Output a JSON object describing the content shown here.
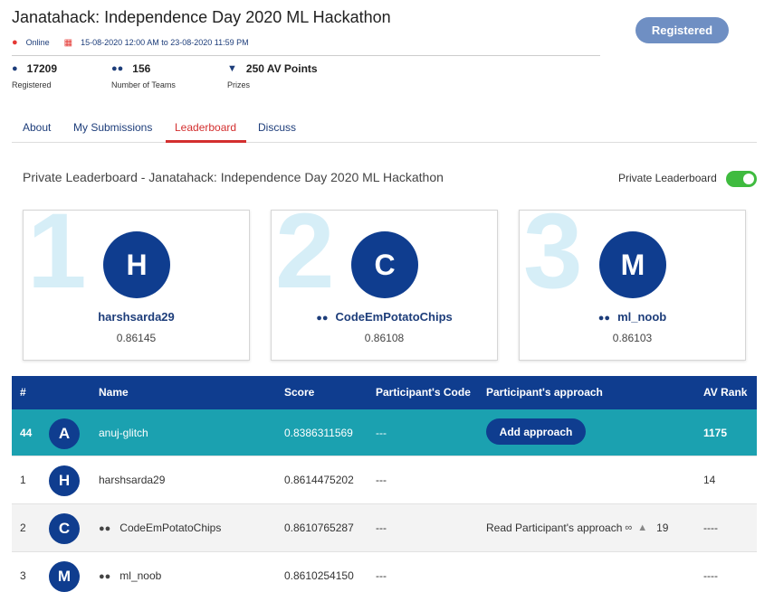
{
  "event": {
    "title": "Janatahack: Independence Day 2020 ML Hackathon",
    "location": "Online",
    "dates": "15-08-2020 12:00 AM to 23-08-2020 11:59 PM",
    "register_label": "Registered"
  },
  "stats": [
    {
      "value": "17209",
      "label": "Registered",
      "icon": "user-icon"
    },
    {
      "value": "156",
      "label": "Number of Teams",
      "icon": "users-icon"
    },
    {
      "value": "250 AV Points",
      "label": "Prizes",
      "icon": "trophy-icon"
    }
  ],
  "tabs": [
    {
      "label": "About"
    },
    {
      "label": "My Submissions"
    },
    {
      "label": "Leaderboard"
    },
    {
      "label": "Discuss"
    }
  ],
  "leaderboard": {
    "title": "Private Leaderboard - Janatahack: Independence Day 2020 ML Hackathon",
    "toggle_label": "Private Leaderboard",
    "toggle_on": true
  },
  "podium": [
    {
      "rank": "1",
      "initial": "H",
      "name": "harshsarda29",
      "score": "0.86145",
      "team": false
    },
    {
      "rank": "2",
      "initial": "C",
      "name": "CodeEmPotatoChips",
      "score": "0.86108",
      "team": true
    },
    {
      "rank": "3",
      "initial": "M",
      "name": "ml_noob",
      "score": "0.86103",
      "team": true
    }
  ],
  "table": {
    "headers": [
      "#",
      "Name",
      "Score",
      "Participant's Code",
      "Participant's approach",
      "AV Rank"
    ],
    "rows": [
      {
        "rank": "44",
        "initial": "A",
        "name": "anuj-glitch",
        "score": "0.8386311569",
        "code": "---",
        "approach": "Add approach",
        "av_rank": "1175"
      },
      {
        "rank": "1",
        "initial": "H",
        "name": "harshsarda29",
        "score": "0.8614475202",
        "code": "---",
        "approach": "",
        "av_rank": "14"
      },
      {
        "rank": "2",
        "initial": "C",
        "name": "CodeEmPotatoChips",
        "score": "0.8610765287",
        "code": "---",
        "approach": "Read Participant's approach",
        "likes": "19",
        "av_rank": "----"
      },
      {
        "rank": "3",
        "initial": "M",
        "name": "ml_noob",
        "score": "0.8610254150",
        "code": "---",
        "approach": "",
        "av_rank": "----"
      }
    ]
  },
  "colors": {
    "primary": "#0f3d8f",
    "highlight_row": "#1ba1b0",
    "active_tab": "#d32f2f",
    "toggle": "#3fbb3f"
  }
}
